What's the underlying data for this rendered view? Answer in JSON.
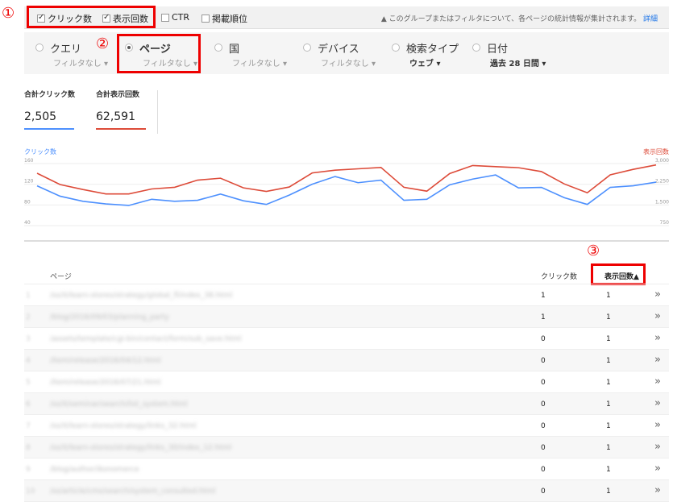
{
  "annotations": {
    "m1": "①",
    "m2": "②",
    "m3": "③"
  },
  "toolbar": {
    "clicks_label": "クリック数",
    "impressions_label": "表示回数",
    "ctr_label": "CTR",
    "position_label": "掲載順位",
    "notice": "このグループまたはフィルタについて、各ページの統計情報が集計されます。",
    "notice_link": "詳細"
  },
  "filters": [
    {
      "label": "クエリ",
      "sub": "フィルタなし"
    },
    {
      "label": "ページ",
      "sub": "フィルタなし"
    },
    {
      "label": "国",
      "sub": "フィルタなし"
    },
    {
      "label": "デバイス",
      "sub": "フィルタなし"
    },
    {
      "label": "検索タイプ",
      "sub": "ウェブ"
    },
    {
      "label": "日付",
      "sub": "過去 28 日間"
    }
  ],
  "totals": {
    "clicks": {
      "label": "合計クリック数",
      "value": "2,505",
      "color": "#4d90fe"
    },
    "impressions": {
      "label": "合計表示回数",
      "value": "62,591",
      "color": "#dd4b39"
    }
  },
  "chart_data": {
    "type": "line",
    "x": [
      1,
      2,
      3,
      4,
      5,
      6,
      7,
      8,
      9,
      10,
      11,
      12,
      13,
      14,
      15,
      16,
      17,
      18,
      19,
      20,
      21,
      22,
      23,
      24,
      25,
      26,
      27,
      28
    ],
    "series": [
      {
        "name": "クリック数",
        "axis": "left",
        "values": [
          117,
          97,
          87,
          82,
          79,
          91,
          87,
          89,
          101,
          88,
          81,
          99,
          120,
          135,
          123,
          128,
          89,
          91,
          119,
          130,
          138,
          113,
          114,
          94,
          81,
          114,
          117,
          124
        ]
      },
      {
        "name": "表示回数",
        "axis": "right",
        "values": [
          2650,
          2240,
          2060,
          1900,
          1900,
          2080,
          2140,
          2400,
          2470,
          2120,
          1990,
          2150,
          2660,
          2760,
          2810,
          2860,
          2140,
          2000,
          2640,
          2930,
          2890,
          2850,
          2710,
          2260,
          1940,
          2590,
          2790,
          2950
        ]
      }
    ],
    "left_axis": {
      "label": "クリック数",
      "ticks": [
        "160",
        "120",
        "80",
        "40"
      ],
      "range": [
        40,
        160
      ]
    },
    "right_axis": {
      "label": "表示回数",
      "ticks": [
        "3,000",
        "2,250",
        "1,500",
        "750"
      ],
      "range": [
        750,
        3000
      ]
    },
    "grid": true
  },
  "table": {
    "headers": {
      "page": "ページ",
      "clicks": "クリック数",
      "impressions": "表示回数▲"
    },
    "rows": [
      {
        "num": "1",
        "url": "/ss/it/learn-stores/strategy/global_fl/index_38.html",
        "clicks": "1",
        "impressions": "1"
      },
      {
        "num": "2",
        "url": "/blog/2016/09/03/planning_party",
        "clicks": "1",
        "impressions": "1"
      },
      {
        "num": "3",
        "url": "/assets/template/cgi-bin/contact/form/sub_save.html",
        "clicks": "0",
        "impressions": "1"
      },
      {
        "num": "4",
        "url": "/item/release/2016/04/12.html",
        "clicks": "0",
        "impressions": "1"
      },
      {
        "num": "5",
        "url": "/item/release/2016/07/21.html",
        "clicks": "0",
        "impressions": "1"
      },
      {
        "num": "6",
        "url": "/ss/it/seminar/search/list_system.html",
        "clicks": "0",
        "impressions": "1"
      },
      {
        "num": "7",
        "url": "/ss/it/learn-stores/strategy/links_32.html",
        "clicks": "0",
        "impressions": "1"
      },
      {
        "num": "8",
        "url": "/ss/it/learn-stores/strategy/links_30/index_12.html",
        "clicks": "0",
        "impressions": "1"
      },
      {
        "num": "9",
        "url": "/blog/author/ikonomerce",
        "clicks": "0",
        "impressions": "1"
      },
      {
        "num": "10",
        "url": "/ss/article/cms/search/system_consulted.html",
        "clicks": "0",
        "impressions": "1"
      }
    ]
  }
}
